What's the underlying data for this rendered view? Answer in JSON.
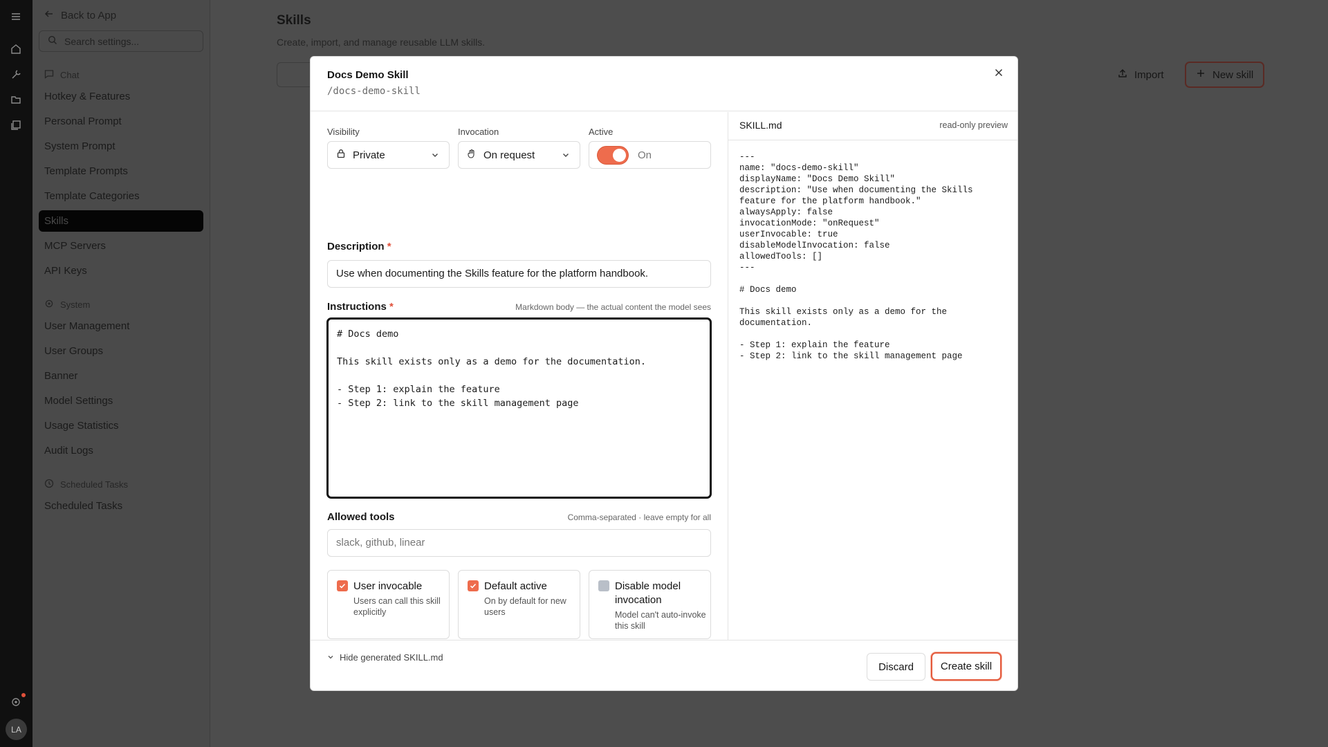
{
  "sidebar": {
    "back_label": "Back to App",
    "search_placeholder": "Search settings...",
    "section_chat": "Chat",
    "chat_items": [
      "Hotkey & Features",
      "Personal Prompt",
      "System Prompt",
      "Template Prompts",
      "Template Categories",
      "Skills",
      "MCP Servers",
      "API Keys"
    ],
    "section_system": "System",
    "system_items": [
      "User Management",
      "User Groups",
      "Banner",
      "Model Settings",
      "Usage Statistics",
      "Audit Logs"
    ],
    "section_tasks": "Scheduled Tasks",
    "task_items": [
      "Scheduled Tasks"
    ],
    "active_item": "Skills",
    "avatar_initials": "LA"
  },
  "page": {
    "title": "Skills",
    "subtitle": "Create, import, and manage reusable LLM skills.",
    "import_label": "Import",
    "new_skill_label": "New skill"
  },
  "modal": {
    "title": "Docs Demo Skill",
    "slug": "/docs-demo-skill",
    "visibility_label": "Visibility",
    "visibility_value": "Private",
    "invocation_label": "Invocation",
    "invocation_value": "On request",
    "active_label": "Active",
    "active_value": "On",
    "active_on": true,
    "description_label": "Description",
    "description_value": "Use when documenting the Skills feature for the platform handbook.",
    "instructions_label": "Instructions",
    "instructions_hint": "Markdown body — the actual content the model sees",
    "instructions_value": "# Docs demo\n\nThis skill exists only as a demo for the documentation.\n\n- Step 1: explain the feature\n- Step 2: link to the skill management page",
    "tools_label": "Allowed tools",
    "tools_hint": "Comma-separated · leave empty for all",
    "tools_placeholder": "slack, github, linear",
    "cards": [
      {
        "title": "User invocable",
        "desc": "Users can call this skill explicitly",
        "checked": true
      },
      {
        "title": "Default active",
        "desc": "On by default for new users",
        "checked": true
      },
      {
        "title": "Disable model invocation",
        "desc": "Model can't auto-invoke this skill",
        "checked": false
      }
    ],
    "hide_generated_label": "Hide generated SKILL.md",
    "preview_title": "SKILL.md",
    "preview_tag": "read-only preview",
    "preview_text": "---\nname: \"docs-demo-skill\"\ndisplayName: \"Docs Demo Skill\"\ndescription: \"Use when documenting the Skills feature for the platform handbook.\"\nalwaysApply: false\ninvocationMode: \"onRequest\"\nuserInvocable: true\ndisableModelInvocation: false\nallowedTools: []\n---\n\n# Docs demo\n\nThis skill exists only as a demo for the documentation.\n\n- Step 1: explain the feature\n- Step 2: link to the skill management page",
    "discard_label": "Discard",
    "create_label": "Create skill",
    "accent_color": "#ee6c4d"
  }
}
